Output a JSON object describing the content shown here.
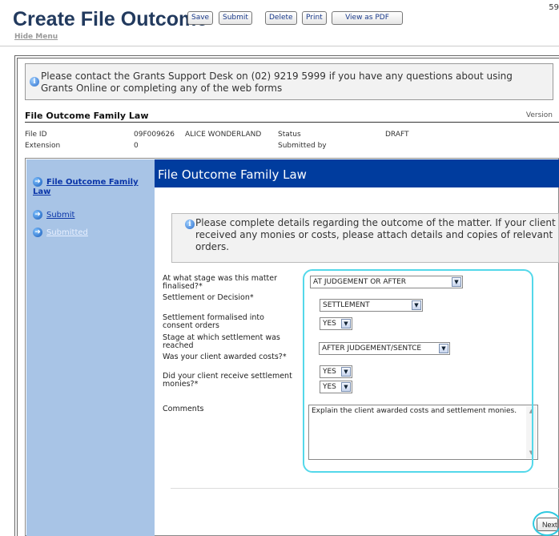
{
  "header": {
    "title": "Create File Outcome",
    "page_num": "59",
    "buttons": {
      "save": "Save",
      "submit": "Submit",
      "delete": "Delete",
      "print": "Print",
      "view_pdf": "View as PDF"
    },
    "hide_menu": "Hide Menu"
  },
  "help": {
    "text": "Please contact the Grants Support Desk on (02) 9219 5999 if you have any questions about using Grants Online or completing any of the web forms"
  },
  "form": {
    "title": "File Outcome Family Law",
    "version_label": "Version"
  },
  "meta": {
    "file_id_label": "File ID",
    "file_id_value": "09F009626",
    "client_name": "ALICE WONDERLAND",
    "extension_label": "Extension",
    "extension_value": "0",
    "status_label": "Status",
    "status_value": "DRAFT",
    "submitted_by_label": "Submitted by"
  },
  "sidebar": {
    "items": [
      {
        "label": "File Outcome Family Law"
      },
      {
        "label": "Submit"
      },
      {
        "label": "Submitted"
      }
    ]
  },
  "section": {
    "title": "File Outcome Family Law",
    "instructions": "Please complete details regarding the outcome of the matter. If your client received any monies or costs, please attach details and copies of relevant orders."
  },
  "questions": [
    {
      "label": "At what stage was this matter finalised?*",
      "value": "AT JUDGEMENT OR AFTER"
    },
    {
      "label": "Settlement or Decision*",
      "value": "SETTLEMENT"
    },
    {
      "label": "Settlement formalised into consent orders",
      "value": "YES"
    },
    {
      "label": "Stage at which settlement was reached",
      "value": "AFTER JUDGEMENT/SENTCE"
    },
    {
      "label": "Was your client awarded costs?*",
      "value": "YES"
    },
    {
      "label": "Did your client receive settlement monies?*",
      "value": "YES"
    },
    {
      "label": "Comments",
      "value": "Explain the client awarded costs and settlement monies."
    }
  ],
  "footer": {
    "next": "Next"
  },
  "colors": {
    "title": "#223a5e",
    "sidebar_bg": "#a8c4e6",
    "section_bar": "#003c9e",
    "highlight": "#54d8ea"
  }
}
